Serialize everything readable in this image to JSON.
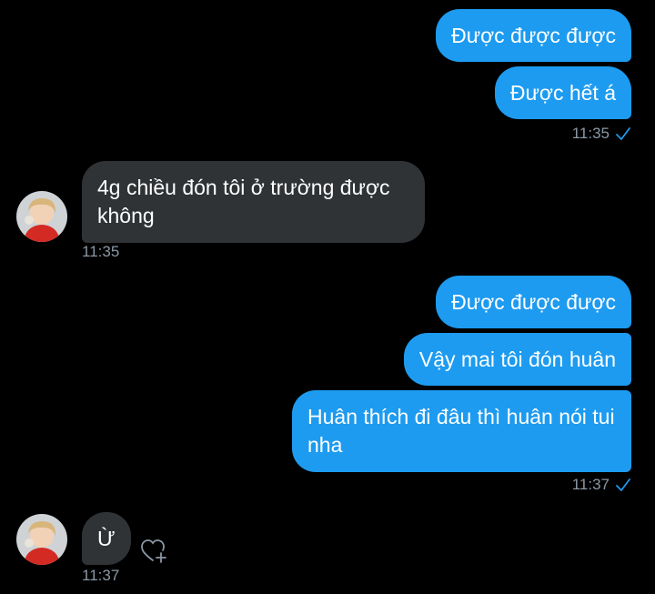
{
  "colors": {
    "background": "#000000",
    "sent_bubble": "#1d9bf0",
    "received_bubble": "#2f3336",
    "timestamp": "#8b98a5",
    "checkmark": "#1d9bf0"
  },
  "messages": {
    "m1": "Được được được",
    "m2": "Được hết á",
    "t1": "11:35",
    "r1": "4g chiều đón tôi ở trường được không",
    "t2": "11:35",
    "m3": "Được được được",
    "m4": "Vậy mai tôi đón huân",
    "m5": "Huân thích đi đâu thì huân nói tui nha",
    "t3": "11:37",
    "r2": "Ừ",
    "t4": "11:37"
  },
  "icons": {
    "sent_status": "checkmark-icon",
    "react": "heart-plus-icon",
    "avatar": "user-avatar"
  }
}
